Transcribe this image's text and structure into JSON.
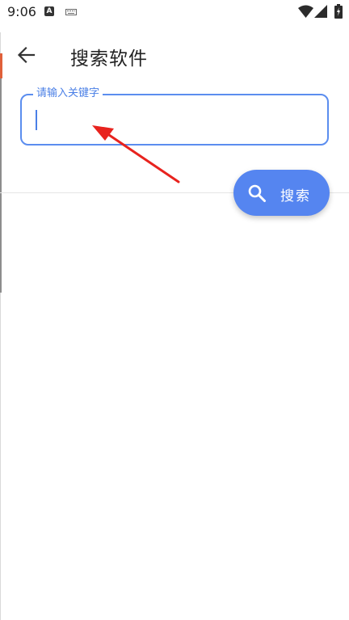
{
  "status_bar": {
    "time": "9:06",
    "notification_icons": [
      "a-notification-icon",
      "keyboard-icon"
    ],
    "system_icons": [
      "wifi-icon",
      "signal-icon",
      "battery-icon"
    ]
  },
  "app_bar": {
    "back_icon": "arrow-left-icon",
    "title": "搜索软件"
  },
  "search_field": {
    "label": "请输入关键字",
    "value": "",
    "accent_color": "#5b8def"
  },
  "search_button": {
    "icon": "search-icon",
    "label": "搜索",
    "color": "#5585f0"
  },
  "annotation": {
    "type": "red-arrow",
    "color": "#e8231e"
  }
}
